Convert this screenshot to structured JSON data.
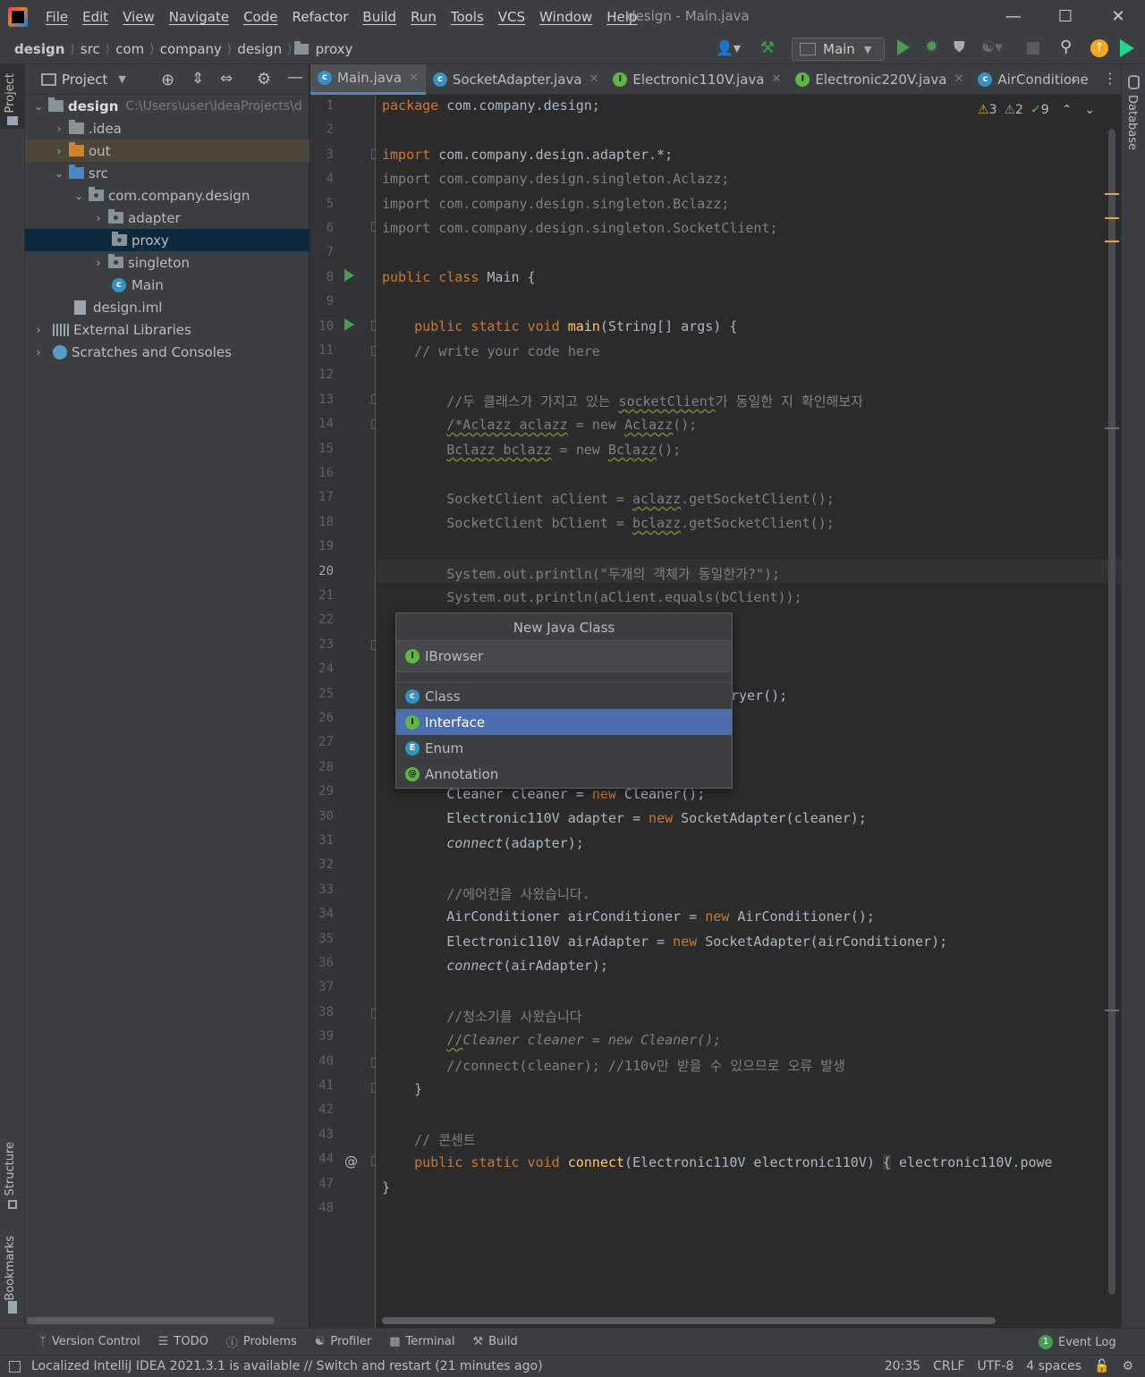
{
  "menubar": {
    "items": [
      "File",
      "Edit",
      "View",
      "Navigate",
      "Code",
      "Refactor",
      "Build",
      "Run",
      "Tools",
      "VCS",
      "Window",
      "Help"
    ],
    "window_title": "design - Main.java"
  },
  "navbar": {
    "crumbs": [
      "design",
      "src",
      "com",
      "company",
      "design",
      "proxy"
    ],
    "run_config": "Main"
  },
  "left_strip": {
    "project": "Project",
    "structure": "Structure",
    "bookmarks": "Bookmarks"
  },
  "right_strip": {
    "database": "Database"
  },
  "project_panel": {
    "title": "Project",
    "root_name": "design",
    "root_path": "C:\\Users\\user\\IdeaProjects\\d",
    "tree": [
      ".idea",
      "out",
      "src",
      "com.company.design",
      "adapter",
      "proxy",
      "singleton",
      "Main",
      "design.iml",
      "External Libraries",
      "Scratches and Consoles"
    ]
  },
  "tabs": [
    "Main.java",
    "SocketAdapter.java",
    "Electronic110V.java",
    "Electronic220V.java",
    "AirConditione"
  ],
  "inspections": {
    "warnings": "3",
    "weak_warnings": "2",
    "typos": "9"
  },
  "line_numbers": [
    "1",
    "2",
    "3",
    "4",
    "5",
    "6",
    "7",
    "8",
    "9",
    "10",
    "11",
    "12",
    "13",
    "14",
    "15",
    "16",
    "17",
    "18",
    "19",
    "20",
    "21",
    "22",
    "23",
    "24",
    "25",
    "26",
    "27",
    "28",
    "29",
    "30",
    "31",
    "32",
    "33",
    "34",
    "35",
    "36",
    "37",
    "38",
    "39",
    "40",
    "41",
    "42",
    "43",
    "44",
    "47",
    "48"
  ],
  "current_line": "20",
  "code": {
    "l1_a": "package",
    "l1_b": " com.company.design;",
    "l3_a": "import",
    "l3_b": " com.company.design.adapter.*;",
    "l4": "import com.company.design.singleton.Aclazz;",
    "l5": "import com.company.design.singleton.Bclazz;",
    "l6": "import com.company.design.singleton.SocketClient;",
    "l8_a": "public class",
    "l8_b": " Main {",
    "l10_a": "    public static void ",
    "l10_b": "main",
    "l10_c": "(String[] args) {",
    "l11": "    // write your code here",
    "l13_a": "        //두 클래스가 가지고 있는 ",
    "l13_b": "socketClient",
    "l13_c": "가 동일한 지 확인해보자",
    "l14_a": "        ",
    "l14_b": "/*Aclazz aclazz",
    "l14_c": " = new ",
    "l14_d": "Aclazz",
    "l14_e": "();",
    "l15_a": "        ",
    "l15_b": "Bclazz bclazz",
    "l15_c": " = new ",
    "l15_d": "Bclazz",
    "l15_e": "();",
    "l17_a": "        SocketClient aClient = ",
    "l17_b": "aclazz",
    "l17_c": ".getSocketClient();",
    "l18_a": "        SocketClient bClient = ",
    "l18_b": "bclazz",
    "l18_c": ".getSocketClient();",
    "l20": "        System.out.println(\"두개의 객체가 동일한가?\");",
    "l21": "        System.out.println(aClient.equals(bClient));",
    "l25": "ryer();",
    "l29_a": "        Cleaner cleaner = ",
    "l29_b": "new",
    "l29_c": " Cleaner();",
    "l30_a": "        Electronic110V adapter = ",
    "l30_b": "new",
    "l30_c": " SocketAdapter(cleaner);",
    "l31_a": "        ",
    "l31_b": "connect",
    "l31_c": "(adapter);",
    "l33": "        //에어컨을 사왔습니다.",
    "l34_a": "        AirConditioner airConditioner = ",
    "l34_b": "new",
    "l34_c": " AirConditioner();",
    "l35_a": "        Electronic110V airAdapter = ",
    "l35_b": "new",
    "l35_c": " SocketAdapter(airConditioner);",
    "l36_a": "        ",
    "l36_b": "connect",
    "l36_c": "(airAdapter);",
    "l38": "        //청소기를 사왔습니다",
    "l39_a": "        ",
    "l39_b": "//",
    "l39_c": "Cleaner cleaner = new Cleaner();",
    "l40": "        //connect(cleaner); //110v만 받을 수 있으므로 오류 발생",
    "l41": "    }",
    "l43": "    // 콘센트",
    "l44_a": "    public static void ",
    "l44_b": "connect",
    "l44_c": "(Electronic110V electronic110V) ",
    "l44_d": "{",
    "l44_e": " electronic110V.powe",
    "l47": "}"
  },
  "popup": {
    "title": "New Java Class",
    "input_value": "IBrowser",
    "options": [
      "Class",
      "Interface",
      "Enum",
      "Annotation"
    ],
    "selected": "Interface"
  },
  "toolwindows": [
    "Version Control",
    "TODO",
    "Problems",
    "Profiler",
    "Terminal",
    "Build",
    "Event Log"
  ],
  "event_log_count": "1",
  "status": {
    "message": "Localized IntelliJ IDEA 2021.3.1 is available // Switch and restart (21 minutes ago)",
    "position": "20:35",
    "line_sep": "CRLF",
    "encoding": "UTF-8",
    "indent": "4 spaces"
  },
  "colors": {
    "keyword": "#cc7832",
    "comment": "#808080",
    "string": "#6a8759",
    "function": "#ffc66d",
    "selection": "#4b6eaf",
    "run": "#499c54"
  }
}
